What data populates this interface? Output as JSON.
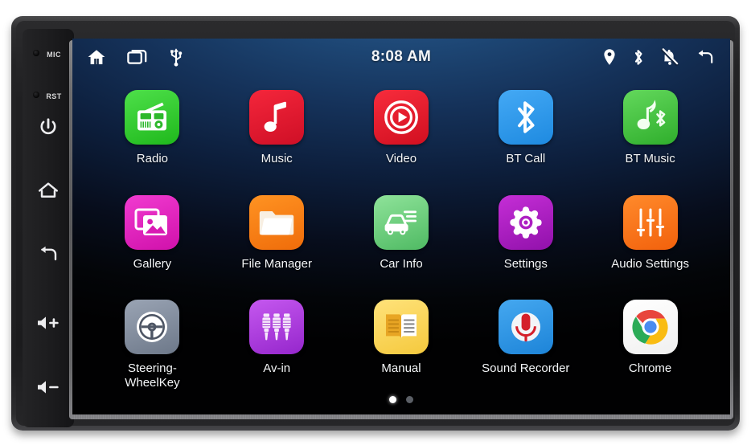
{
  "device": {
    "side_keys": [
      {
        "name": "mic",
        "label": "MIC",
        "type": "led-label"
      },
      {
        "name": "reset",
        "label": "RST",
        "type": "led-label"
      },
      {
        "name": "power",
        "label": "",
        "icon": "power-icon"
      },
      {
        "name": "home",
        "label": "",
        "icon": "home-outline-icon"
      },
      {
        "name": "back",
        "label": "",
        "icon": "back-arrow-icon"
      },
      {
        "name": "volume-up",
        "label": "",
        "icon": "volume-up-icon"
      },
      {
        "name": "volume-down",
        "label": "",
        "icon": "volume-down-icon"
      }
    ]
  },
  "statusbar": {
    "clock": "8:08 AM",
    "left_icons": [
      {
        "name": "home-icon",
        "title": "Home"
      },
      {
        "name": "recent-apps-icon",
        "title": "Recent apps"
      },
      {
        "name": "usb-icon",
        "title": "USB"
      }
    ],
    "right_icons": [
      {
        "name": "location-pin-icon",
        "title": "Location"
      },
      {
        "name": "bluetooth-icon",
        "title": "Bluetooth"
      },
      {
        "name": "notifications-off-icon",
        "title": "Notifications muted"
      },
      {
        "name": "back-arrow-icon",
        "title": "Back"
      }
    ]
  },
  "apps": [
    {
      "id": "radio",
      "label": "Radio",
      "icon": "radio-icon",
      "bg_start": "#4ee04a",
      "bg_end": "#1fb81c"
    },
    {
      "id": "music",
      "label": "Music",
      "icon": "music-note-icon",
      "bg_start": "#f4263b",
      "bg_end": "#cf0f26"
    },
    {
      "id": "video",
      "label": "Video",
      "icon": "video-play-icon",
      "bg_start": "#f72c3c",
      "bg_end": "#d10f20"
    },
    {
      "id": "bt-call",
      "label": "BT Call",
      "icon": "bluetooth-icon",
      "bg_start": "#44a9f5",
      "bg_end": "#1e8ae0"
    },
    {
      "id": "bt-music",
      "label": "BT Music",
      "icon": "bt-music-icon",
      "bg_start": "#63d85c",
      "bg_end": "#2fae2c"
    },
    {
      "id": "gallery",
      "label": "Gallery",
      "icon": "gallery-icon",
      "bg_start": "#f13bd0",
      "bg_end": "#d011ab"
    },
    {
      "id": "file-manager",
      "label": "File Manager",
      "icon": "folder-icon",
      "bg_start": "#ff9322",
      "bg_end": "#ef6c0a"
    },
    {
      "id": "car-info",
      "label": "Car Info",
      "icon": "car-info-icon",
      "bg_start": "#8fe39a",
      "bg_end": "#4fba63"
    },
    {
      "id": "settings",
      "label": "Settings",
      "icon": "gear-icon",
      "bg_start": "#c52ed6",
      "bg_end": "#9111ab"
    },
    {
      "id": "audio-settings",
      "label": "Audio Settings",
      "icon": "equalizer-icon",
      "bg_start": "#ff8a2b",
      "bg_end": "#f2610c"
    },
    {
      "id": "steering-wheelkey",
      "label": "Steering-\nWheelKey",
      "icon": "steering-wheel-icon",
      "bg_start": "#9aa4b4",
      "bg_end": "#6d7889"
    },
    {
      "id": "av-in",
      "label": "Av-in",
      "icon": "rca-plugs-icon",
      "bg_start": "#c558ef",
      "bg_end": "#9526cc"
    },
    {
      "id": "manual",
      "label": "Manual",
      "icon": "book-icon",
      "bg_start": "#ffe27a",
      "bg_end": "#f5c93d"
    },
    {
      "id": "sound-recorder",
      "label": "Sound Recorder",
      "icon": "microphone-icon",
      "bg_start": "#45a8f0",
      "bg_end": "#1d84d8"
    },
    {
      "id": "chrome",
      "label": "Chrome",
      "icon": "chrome-icon",
      "bg_start": "#ffffff",
      "bg_end": "#f0f0f0"
    }
  ],
  "pager": {
    "count": 2,
    "active_index": 0
  }
}
